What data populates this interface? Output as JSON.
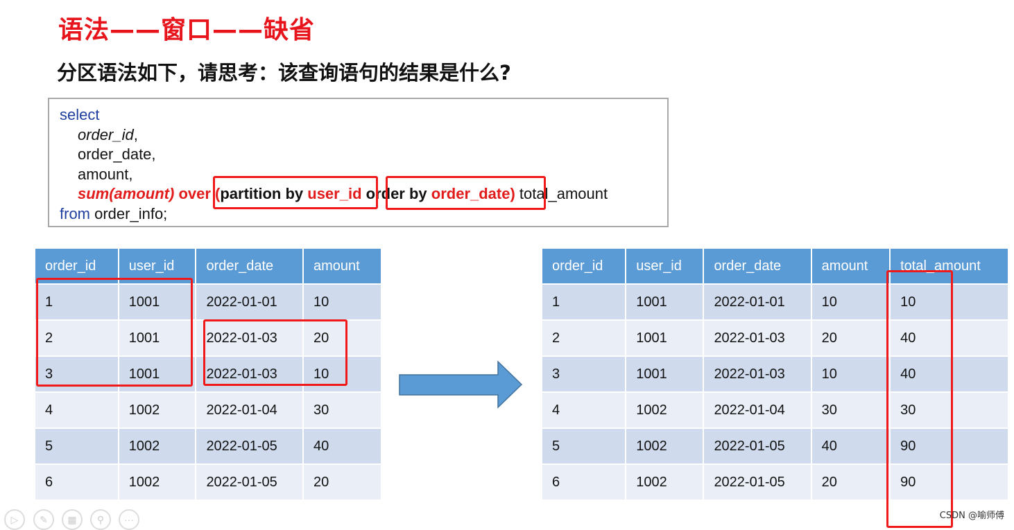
{
  "title": "语法——窗口——缺省",
  "question": "分区语法如下，请思考：该查询语句的结果是什么?",
  "code": {
    "select": "select",
    "col1": "order_id",
    "col2": "order_date,",
    "col3": "amount,",
    "sum": "sum(amount)",
    "over": " over ",
    "paren_open": "(",
    "partition_by": "partition by ",
    "user_id": "user_id",
    "order_by": " order by ",
    "order_date": "order_date",
    "paren_close": ")",
    "alias": " total_amount",
    "from": "from",
    "table": " order_info;"
  },
  "left_table": {
    "headers": [
      "order_id",
      "user_id",
      "order_date",
      "amount"
    ],
    "rows": [
      [
        "1",
        "1001",
        "2022-01-01",
        "10"
      ],
      [
        "2",
        "1001",
        "2022-01-03",
        "20"
      ],
      [
        "3",
        "1001",
        "2022-01-03",
        "10"
      ],
      [
        "4",
        "1002",
        "2022-01-04",
        "30"
      ],
      [
        "5",
        "1002",
        "2022-01-05",
        "40"
      ],
      [
        "6",
        "1002",
        "2022-01-05",
        "20"
      ]
    ]
  },
  "right_table": {
    "headers": [
      "order_id",
      "user_id",
      "order_date",
      "amount",
      "total_amount"
    ],
    "rows": [
      [
        "1",
        "1001",
        "2022-01-01",
        "10",
        "10"
      ],
      [
        "2",
        "1001",
        "2022-01-03",
        "20",
        "40"
      ],
      [
        "3",
        "1001",
        "2022-01-03",
        "10",
        "40"
      ],
      [
        "4",
        "1002",
        "2022-01-04",
        "30",
        "30"
      ],
      [
        "5",
        "1002",
        "2022-01-05",
        "40",
        "90"
      ],
      [
        "6",
        "1002",
        "2022-01-05",
        "20",
        "90"
      ]
    ]
  },
  "footer": "CSDN @喻师傅",
  "colors": {
    "title": "#e8141c",
    "header": "#5b9bd5",
    "highlight": "#f01818",
    "arrow": "#5b9bd5"
  },
  "controls": [
    "play-icon",
    "pen-icon",
    "slides-icon",
    "zoom-icon",
    "more-icon"
  ]
}
